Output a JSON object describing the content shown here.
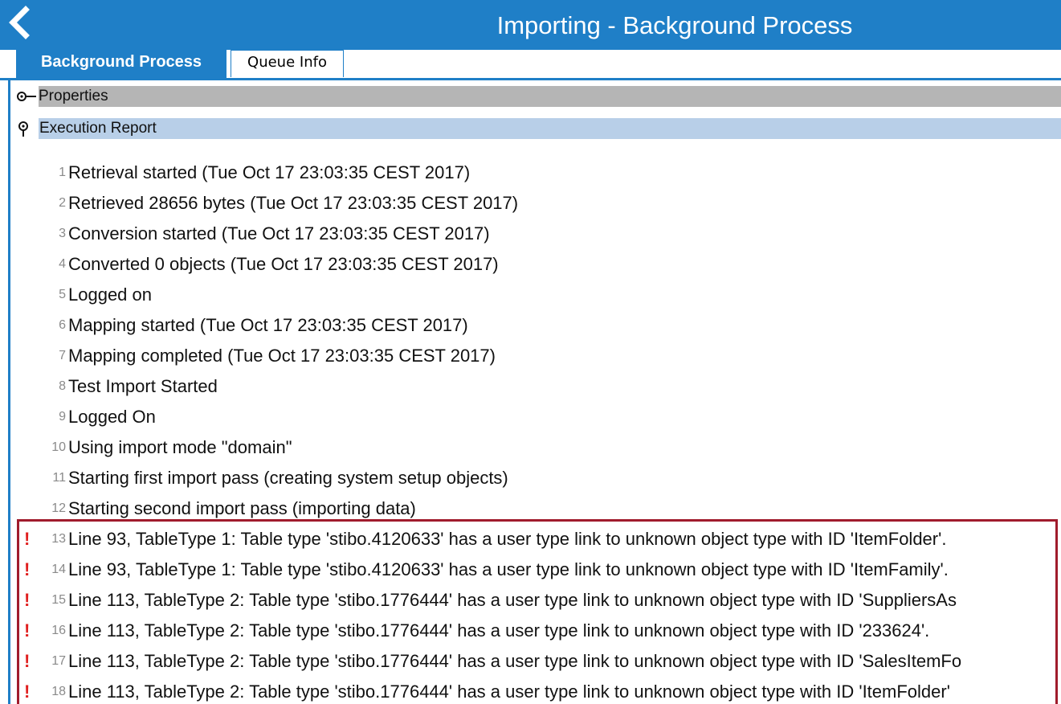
{
  "window": {
    "title": "Importing  - Background Process",
    "back_icon": "chevron-left-icon"
  },
  "tabs": [
    {
      "label": "Background Process",
      "active": true
    },
    {
      "label": "Queue Info",
      "active": false
    }
  ],
  "sections": {
    "properties": {
      "label": "Properties",
      "icon": "collapsed-node-icon"
    },
    "execution_report": {
      "label": "Execution Report",
      "icon": "expanded-node-icon"
    }
  },
  "colors": {
    "accent": "#1f7fc7",
    "properties_bar": "#b5b5b5",
    "execution_bar": "#b8cfe8",
    "error_marker": "#e02020",
    "error_box": "#a01c2c"
  },
  "log_lines": [
    {
      "num": "1",
      "text": "Retrieval started (Tue Oct 17 23:03:35 CEST 2017)",
      "error": false
    },
    {
      "num": "2",
      "text": "Retrieved 28656 bytes (Tue Oct 17 23:03:35 CEST 2017)",
      "error": false
    },
    {
      "num": "3",
      "text": "Conversion started (Tue Oct 17 23:03:35 CEST 2017)",
      "error": false
    },
    {
      "num": "4",
      "text": "Converted 0 objects (Tue Oct 17 23:03:35 CEST 2017)",
      "error": false
    },
    {
      "num": "5",
      "text": "Logged on",
      "error": false
    },
    {
      "num": "6",
      "text": "Mapping started (Tue Oct 17 23:03:35 CEST 2017)",
      "error": false
    },
    {
      "num": "7",
      "text": "Mapping completed (Tue Oct 17 23:03:35 CEST 2017)",
      "error": false
    },
    {
      "num": "8",
      "text": "Test Import Started",
      "error": false
    },
    {
      "num": "9",
      "text": "Logged On",
      "error": false
    },
    {
      "num": "10",
      "text": "Using import mode \"domain\"",
      "error": false
    },
    {
      "num": "11",
      "text": "Starting first import pass (creating system setup objects)",
      "error": false
    },
    {
      "num": "12",
      "text": "Starting second import pass (importing data)",
      "error": false
    },
    {
      "num": "13",
      "text": "Line 93, TableType 1: Table type 'stibo.4120633' has a user type link to unknown object type with ID 'ItemFolder'.",
      "error": true
    },
    {
      "num": "14",
      "text": "Line 93, TableType 1: Table type 'stibo.4120633' has a user type link to unknown object type with ID 'ItemFamily'.",
      "error": true
    },
    {
      "num": "15",
      "text": "Line 113, TableType 2: Table type 'stibo.1776444' has a user type link to unknown object type with ID 'SuppliersAs",
      "error": true
    },
    {
      "num": "16",
      "text": "Line 113, TableType 2: Table type 'stibo.1776444' has a user type link to unknown object type with ID '233624'.",
      "error": true
    },
    {
      "num": "17",
      "text": "Line 113, TableType 2: Table type 'stibo.1776444' has a user type link to unknown object type with ID 'SalesItemFo",
      "error": true
    },
    {
      "num": "18",
      "text": "Line 113, TableType 2: Table type 'stibo.1776444' has a user type link to unknown object type with ID 'ItemFolder'",
      "error": true
    }
  ],
  "error_marker": "!"
}
